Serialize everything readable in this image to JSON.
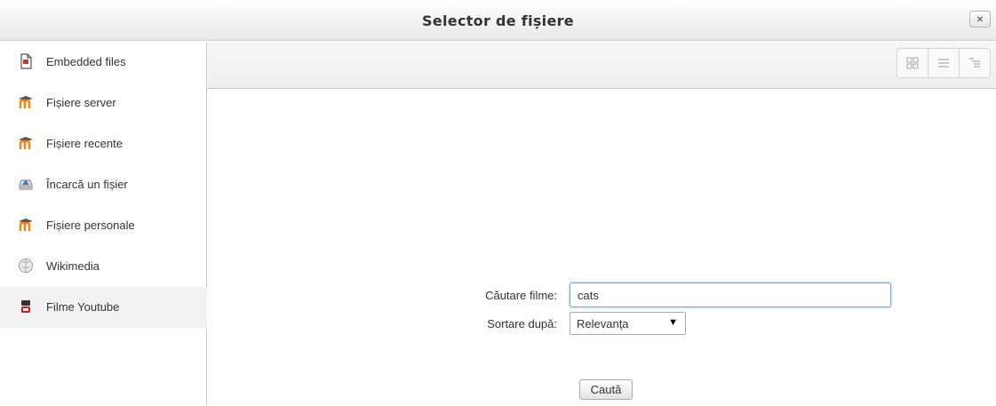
{
  "window": {
    "title": "Selector de fișiere",
    "close_label": "×"
  },
  "sidebar": {
    "items": [
      {
        "label": "Embedded files",
        "icon": "document-icon"
      },
      {
        "label": "Fișiere server",
        "icon": "moodle-icon"
      },
      {
        "label": "Fișiere recente",
        "icon": "moodle-icon"
      },
      {
        "label": "Încarcă un fișier",
        "icon": "upload-icon"
      },
      {
        "label": "Fișiere personale",
        "icon": "moodle-icon"
      },
      {
        "label": "Wikimedia",
        "icon": "wikimedia-icon"
      },
      {
        "label": "Filme Youtube",
        "icon": "youtube-icon",
        "active": true
      }
    ]
  },
  "toolbar": {
    "views": [
      "icons-view",
      "list-view",
      "tree-view"
    ]
  },
  "form": {
    "search_label": "Căutare filme:",
    "search_value": "cats",
    "sort_label": "Sortare după:",
    "sort_value": "Relevanța",
    "sort_arrow": "▼",
    "submit_label": "Caută"
  },
  "colors": {
    "accent_border": "#7da2ce",
    "moodle_orange": "#f98012",
    "youtube_red": "#cc181e"
  }
}
